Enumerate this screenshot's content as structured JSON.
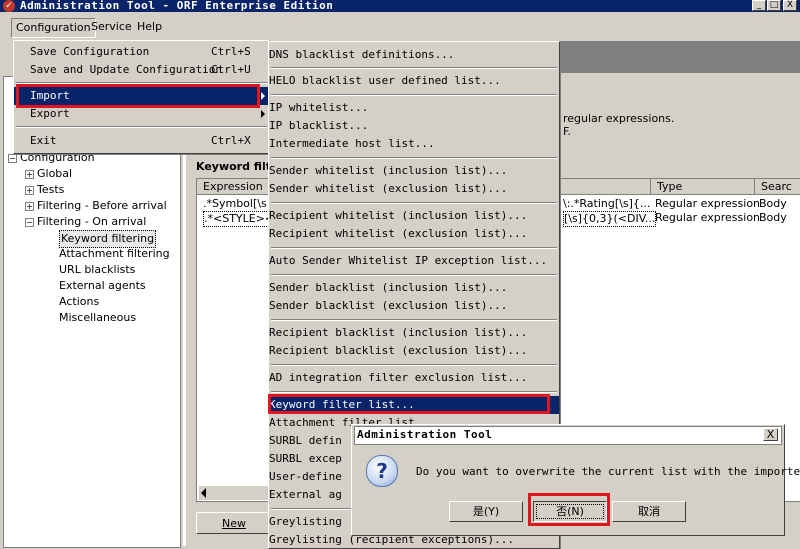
{
  "window": {
    "title": "Administration Tool - ORF Enterprise Edition",
    "controls": [
      "_",
      "□",
      "X"
    ]
  },
  "menubar": {
    "items": [
      "Configuration",
      "Service",
      "Help"
    ]
  },
  "config_menu": {
    "items": [
      {
        "label": "Save Configuration",
        "shortcut": "Ctrl+S"
      },
      {
        "label": "Save and Update Configuration",
        "shortcut": "Ctrl+U"
      },
      {
        "label": "Import",
        "shortcut": ""
      },
      {
        "label": "Export",
        "shortcut": ""
      },
      {
        "label": "Exit",
        "shortcut": "Ctrl+X"
      }
    ]
  },
  "import_menu": {
    "items": [
      "DNS blacklist definitions...",
      "HELO blacklist user defined list...",
      "IP whitelist...",
      "IP blacklist...",
      "Intermediate host list...",
      "Sender whitelist (inclusion list)...",
      "Sender whitelist (exclusion list)...",
      "Recipient whitelist (inclusion list)...",
      "Recipient whitelist (exclusion list)...",
      "Auto Sender Whitelist IP exception list...",
      "Sender blacklist (inclusion list)...",
      "Sender blacklist (exclusion list)...",
      "Recipient blacklist (inclusion list)...",
      "Recipient blacklist (exclusion list)...",
      "AD integration filter exclusion list...",
      "Keyword filter list...",
      "Attachment filter list...",
      "SURBL defin",
      "SURBL excep",
      "User-define",
      "External ag",
      "Greylisting",
      "Greylisting (recipient exceptions)..."
    ]
  },
  "tree": {
    "root": "Configuration",
    "items": [
      "Global",
      "Tests",
      "Filtering - Before arrival",
      "Filtering - On arrival"
    ],
    "children": [
      "Keyword filtering",
      "Attachment filtering",
      "URL blacklists",
      "External agents",
      "Actions",
      "Miscellaneous"
    ]
  },
  "main": {
    "description": "regular expressions.",
    "description_tail": "F.",
    "section_title": "Keyword filt",
    "columns": [
      "Expression",
      "Type",
      "Searc"
    ],
    "rows": [
      {
        "expression": ".*Symbol[\\s]·",
        "mid": "\\:.*Rating[\\s]{...",
        "type": "Regular expression",
        "search": "Body"
      },
      {
        "expression": ".*<STYLE><",
        "mid": "[\\s]{0,3}(<DIV...",
        "type": "Regular expression",
        "search": "Body"
      }
    ],
    "new_button": "New"
  },
  "dialog": {
    "title": "Administration Tool",
    "message": "Do you want to overwrite the current list with the imported?",
    "buttons": {
      "yes": "是(Y)",
      "no": "否(N)",
      "cancel": "取消"
    },
    "close": "X",
    "icon": "question-icon"
  },
  "colors": {
    "highlight": "#0a246a",
    "callout": "#e0151d",
    "face": "#d4d0c8"
  }
}
